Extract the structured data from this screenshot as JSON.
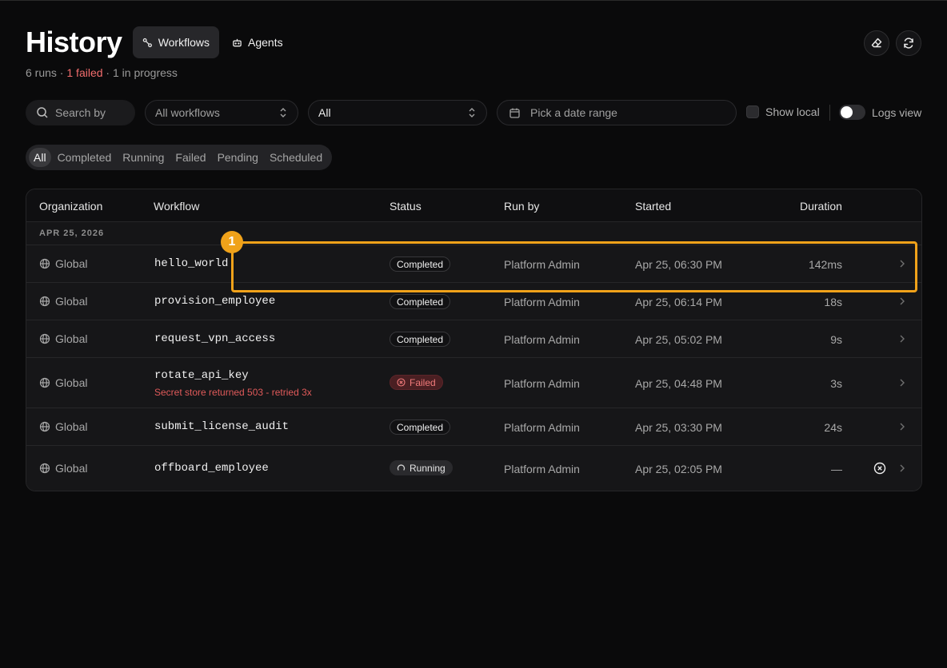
{
  "page": {
    "title": "History",
    "tabs": [
      {
        "label": "Workflows",
        "icon": "workflow-icon",
        "active": true
      },
      {
        "label": "Agents",
        "icon": "bot-icon",
        "active": false
      }
    ],
    "summary": {
      "runs": "6 runs",
      "sep1": " · ",
      "failed": "1 failed",
      "sep2": " · ",
      "in_progress": "1 in progress"
    },
    "actions": {
      "erase_icon": "eraser-icon",
      "refresh_icon": "refresh-icon"
    }
  },
  "filters": {
    "search_placeholder": "Search by",
    "workflow_select": "All workflows",
    "status_select": "All",
    "date_placeholder": "Pick a date range",
    "show_local": "Show local",
    "logs_view": "Logs view"
  },
  "segments": [
    "All",
    "Completed",
    "Running",
    "Failed",
    "Pending",
    "Scheduled"
  ],
  "active_segment": "All",
  "table": {
    "columns": [
      "Organization",
      "Workflow",
      "Status",
      "Run by",
      "Started",
      "Duration"
    ],
    "group_label": "APR 25, 2026",
    "rows": [
      {
        "org": "Global",
        "workflow": "hello_world",
        "status": "Completed",
        "run_by": "Platform Admin",
        "started": "Apr 25, 06:30 PM",
        "duration": "142ms"
      },
      {
        "org": "Global",
        "workflow": "provision_employee",
        "status": "Completed",
        "run_by": "Platform Admin",
        "started": "Apr 25, 06:14 PM",
        "duration": "18s"
      },
      {
        "org": "Global",
        "workflow": "request_vpn_access",
        "status": "Completed",
        "run_by": "Platform Admin",
        "started": "Apr 25, 05:02 PM",
        "duration": "9s"
      },
      {
        "org": "Global",
        "workflow": "rotate_api_key",
        "error": "Secret store returned 503 - retried 3x",
        "status": "Failed",
        "run_by": "Platform Admin",
        "started": "Apr 25, 04:48 PM",
        "duration": "3s"
      },
      {
        "org": "Global",
        "workflow": "submit_license_audit",
        "status": "Completed",
        "run_by": "Platform Admin",
        "started": "Apr 25, 03:30 PM",
        "duration": "24s"
      },
      {
        "org": "Global",
        "workflow": "offboard_employee",
        "status": "Running",
        "run_by": "Platform Admin",
        "started": "Apr 25, 02:05 PM",
        "duration": "—"
      }
    ]
  },
  "highlight": {
    "marker": "1",
    "color": "#f0a21a"
  },
  "colors": {
    "failed_text": "#f26d6d",
    "background": "#0a0a0b"
  }
}
